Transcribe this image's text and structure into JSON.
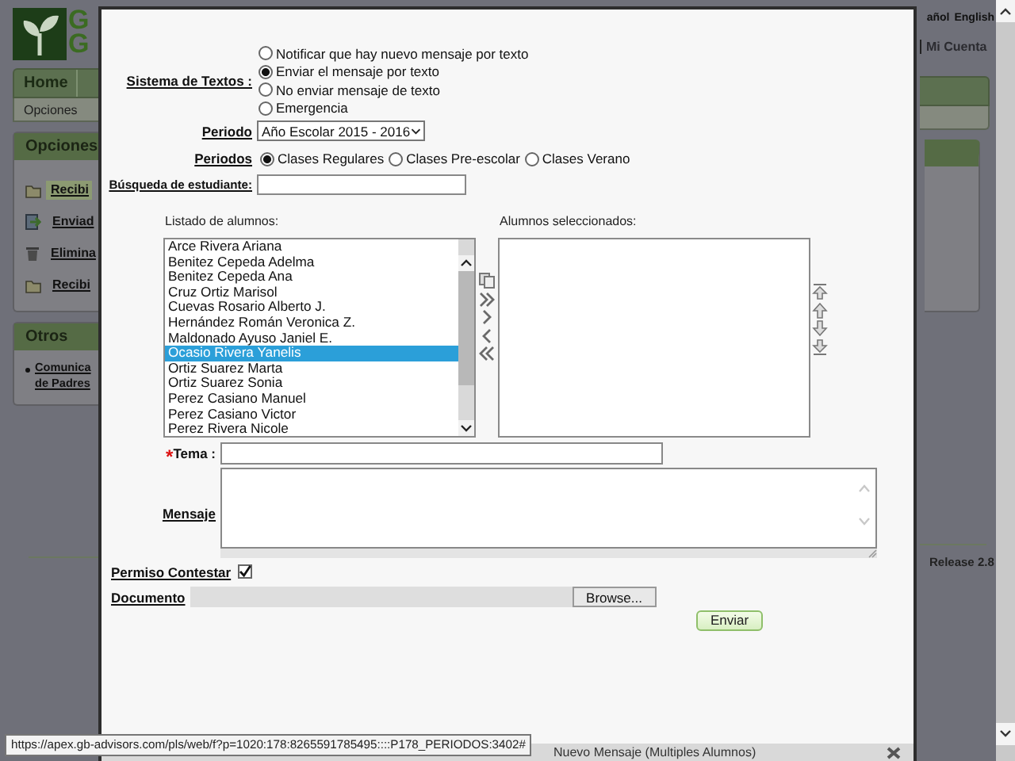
{
  "page": {
    "logo_letters": [
      "G",
      "G"
    ],
    "nav_tab": "Home",
    "subnav": "Opciones",
    "language_links": [
      "añol",
      "English"
    ],
    "account_link": "Mi Cuenta",
    "release": "Release 2.8"
  },
  "sidebar": [
    {
      "title": "Opciones",
      "items": [
        {
          "label": "Recibi",
          "kind": "folder",
          "selected": true
        },
        {
          "label": "Enviad",
          "kind": "send",
          "selected": false
        },
        {
          "label": "Elimina",
          "kind": "trash",
          "selected": false
        },
        {
          "label": "Recibi",
          "kind": "folder",
          "selected": false
        }
      ]
    },
    {
      "title": "Otros",
      "items": [
        {
          "label": "Comunica de Padres",
          "kind": "bullet",
          "selected": false
        }
      ]
    }
  ],
  "modal": {
    "title": "Nuevo Mensaje (Multiples Alumnos)",
    "sms": {
      "label": "Sistema de Textos :",
      "options": [
        {
          "label": "Notificar que hay nuevo mensaje por texto",
          "selected": false
        },
        {
          "label": "Enviar el mensaje por texto",
          "selected": true
        },
        {
          "label": "No enviar mensaje de texto",
          "selected": false
        },
        {
          "label": "Emergencia",
          "selected": false
        }
      ]
    },
    "period": {
      "label": "Periodo",
      "value": "Año Escolar 2015 - 2016"
    },
    "periods": {
      "label": "Periodos",
      "options": [
        {
          "label": "Clases Regulares",
          "selected": true
        },
        {
          "label": "Clases Pre-escolar",
          "selected": false
        },
        {
          "label": "Clases Verano",
          "selected": false
        }
      ]
    },
    "search": {
      "label": "Búsqueda de estudiante:"
    },
    "students": {
      "label": "Listado de alumnos:",
      "items": [
        {
          "name": "Arce Rivera Ariana",
          "selected": false
        },
        {
          "name": "Benitez Cepeda Adelma",
          "selected": false
        },
        {
          "name": "Benitez Cepeda Ana",
          "selected": false
        },
        {
          "name": "Cruz Ortiz Marisol",
          "selected": false
        },
        {
          "name": "Cuevas Rosario Alberto J.",
          "selected": false
        },
        {
          "name": "Hernández Román Veronica Z.",
          "selected": false
        },
        {
          "name": "Maldonado Ayuso Janiel E.",
          "selected": false
        },
        {
          "name": "Ocasio Rivera Yanelis",
          "selected": true
        },
        {
          "name": "Ortiz Suarez Marta",
          "selected": false
        },
        {
          "name": "Ortiz Suarez Sonia",
          "selected": false
        },
        {
          "name": "Perez Casiano Manuel",
          "selected": false
        },
        {
          "name": "Perez Casiano Victor",
          "selected": false
        },
        {
          "name": "Perez Rivera Nicole",
          "selected": false
        }
      ]
    },
    "selected_students": {
      "label": "Alumnos seleccionados:"
    },
    "subject": {
      "required_mark": "*",
      "label": "Tema :"
    },
    "message": {
      "label": "Mensaje"
    },
    "allow_reply": {
      "label": "Permiso Contestar",
      "checked": true
    },
    "document": {
      "label": "Documento",
      "button": "Browse..."
    },
    "send_button": "Enviar"
  },
  "status_url": "https://apex.gb-advisors.com/pls/web/f?p=1020:178:8265591785495::::P178_PERIODOS:3402#"
}
